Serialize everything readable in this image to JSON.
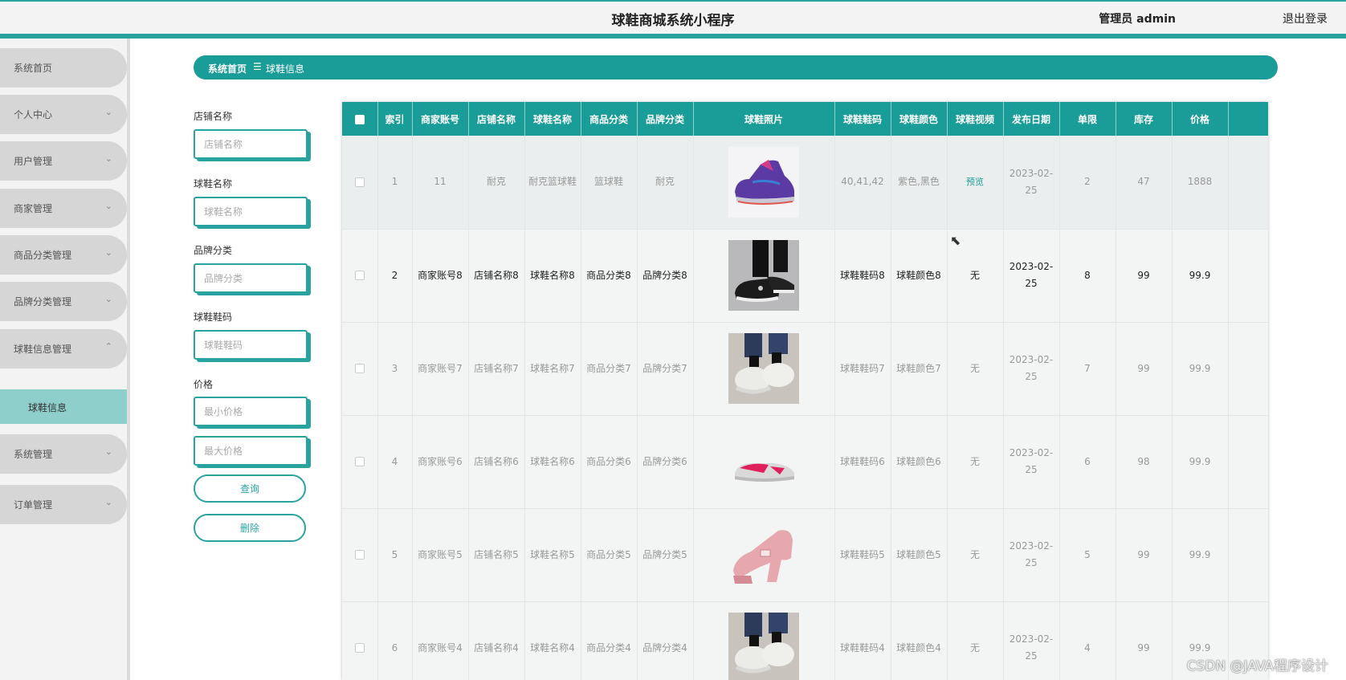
{
  "header": {
    "title": "球鞋商城系统小程序",
    "admin": "管理员 admin",
    "logout": "退出登录"
  },
  "sidebar": {
    "items": [
      {
        "label": "系统首页",
        "chev": ""
      },
      {
        "label": "个人中心",
        "chev": "⌄"
      },
      {
        "label": "用户管理",
        "chev": "⌄"
      },
      {
        "label": "商家管理",
        "chev": "⌄"
      },
      {
        "label": "商品分类管理",
        "chev": "⌄"
      },
      {
        "label": "品牌分类管理",
        "chev": "⌄"
      },
      {
        "label": "球鞋信息管理",
        "chev": "⌃"
      },
      {
        "label": "系统管理",
        "chev": "⌄"
      },
      {
        "label": "订单管理",
        "chev": "⌄"
      }
    ],
    "active_sub": "球鞋信息"
  },
  "breadcrumb": {
    "home": "系统首页",
    "sep": "☰",
    "current": "球鞋信息"
  },
  "filters": {
    "shop_label": "店铺名称",
    "shop_placeholder": "店铺名称",
    "shoe_label": "球鞋名称",
    "shoe_placeholder": "球鞋名称",
    "brand_label": "品牌分类",
    "brand_placeholder": "品牌分类",
    "size_label": "球鞋鞋码",
    "size_placeholder": "球鞋鞋码",
    "price_label": "价格",
    "min_placeholder": "最小价格",
    "max_placeholder": "最大价格",
    "query_button": "查询",
    "delete_button": "删除"
  },
  "table": {
    "headers": [
      "索引",
      "商家账号",
      "店铺名称",
      "球鞋名称",
      "商品分类",
      "品牌分类",
      "球鞋照片",
      "球鞋鞋码",
      "球鞋颜色",
      "球鞋视频",
      "发布日期",
      "单限",
      "库存",
      "价格"
    ],
    "rows": [
      {
        "idx": "1",
        "account": "11",
        "shop": "耐克",
        "name": "耐克篮球鞋",
        "category": "篮球鞋",
        "brand": "耐克",
        "photo": "purple-basketball-shoe",
        "size": "40,41,42",
        "color": "紫色,黑色",
        "video": "预览",
        "date": "2023-02-25",
        "limit": "2",
        "stock": "47",
        "price": "1888"
      },
      {
        "idx": "2",
        "account": "商家账号8",
        "shop": "店铺名称8",
        "name": "球鞋名称8",
        "category": "商品分类8",
        "brand": "品牌分类8",
        "photo": "black-sneaker-worn",
        "size": "球鞋鞋码8",
        "color": "球鞋颜色8",
        "video": "无",
        "date": "2023-02-25",
        "limit": "8",
        "stock": "99",
        "price": "99.9"
      },
      {
        "idx": "3",
        "account": "商家账号7",
        "shop": "店铺名称7",
        "name": "球鞋名称7",
        "category": "商品分类7",
        "brand": "品牌分类7",
        "photo": "white-chunky-sneaker",
        "size": "球鞋鞋码7",
        "color": "球鞋颜色7",
        "video": "无",
        "date": "2023-02-25",
        "limit": "7",
        "stock": "99",
        "price": "99.9"
      },
      {
        "idx": "4",
        "account": "商家账号6",
        "shop": "店铺名称6",
        "name": "球鞋名称6",
        "category": "商品分类6",
        "brand": "品牌分类6",
        "photo": "pink-glitter-sneaker",
        "size": "球鞋鞋码6",
        "color": "球鞋颜色6",
        "video": "无",
        "date": "2023-02-25",
        "limit": "6",
        "stock": "98",
        "price": "99.9"
      },
      {
        "idx": "5",
        "account": "商家账号5",
        "shop": "店铺名称5",
        "name": "球鞋名称5",
        "category": "商品分类5",
        "brand": "品牌分类5",
        "photo": "pink-platform-heel",
        "size": "球鞋鞋码5",
        "color": "球鞋颜色5",
        "video": "无",
        "date": "2023-02-25",
        "limit": "5",
        "stock": "99",
        "price": "99.9"
      },
      {
        "idx": "6",
        "account": "商家账号4",
        "shop": "店铺名称4",
        "name": "球鞋名称4",
        "category": "商品分类4",
        "brand": "品牌分类4",
        "photo": "white-chunky-sneaker",
        "size": "球鞋鞋码4",
        "color": "球鞋颜色4",
        "video": "无",
        "date": "2023-02-25",
        "limit": "4",
        "stock": "99",
        "price": "99.9"
      }
    ]
  },
  "watermark": "CSDN @JAVA程序设计",
  "colors": {
    "accent": "#1a9c98",
    "accent_light": "#8fcfcb",
    "sidebar_pill": "#d6d6d6"
  }
}
